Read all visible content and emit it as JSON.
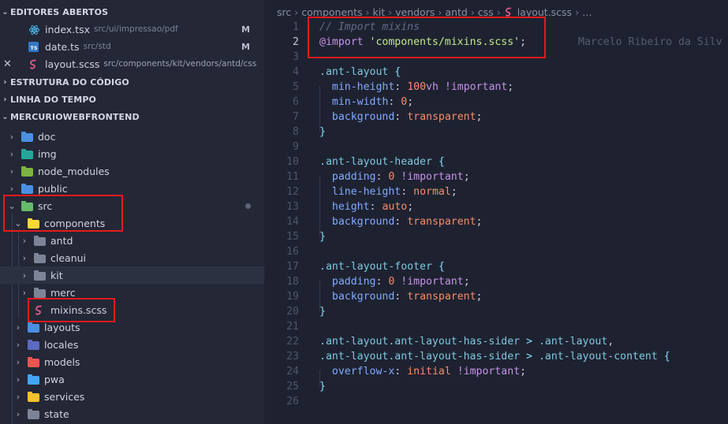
{
  "sidebar": {
    "open_editors": {
      "title": "EDITORES ABERTOS",
      "files": [
        {
          "name": "index.tsx",
          "path": "src/ui/impressao/pdf",
          "badge": "M"
        },
        {
          "name": "date.ts",
          "path": "src/std",
          "badge": "M"
        },
        {
          "name": "layout.scss",
          "path": "src/components/kit/vendors/antd/css",
          "badge": ""
        }
      ]
    },
    "outline_title": "ESTRUTURA DO CÓDIGO",
    "timeline_title": "LINHA DO TEMPO",
    "project_title": "MERCURIOWEBFRONTEND",
    "tree": [
      {
        "label": "doc",
        "color": "#4a90e2",
        "open": false
      },
      {
        "label": "img",
        "color": "#26a69a",
        "open": false
      },
      {
        "label": "node_modules",
        "color": "#7cb342",
        "open": false
      },
      {
        "label": "public",
        "color": "#4a90e2",
        "open": false
      },
      {
        "label": "src",
        "color": "#66bb6a",
        "open": true
      },
      {
        "label": "components",
        "color": "#fdd835",
        "open": true
      },
      {
        "label": "antd",
        "color": "#7e8497",
        "open": false
      },
      {
        "label": "cleanui",
        "color": "#7e8497",
        "open": false
      },
      {
        "label": "kit",
        "color": "#7e8497",
        "open": false
      },
      {
        "label": "merc",
        "color": "#7e8497",
        "open": false
      },
      {
        "label": "mixins.scss",
        "color": "#e05c8a",
        "open": false
      },
      {
        "label": "layouts",
        "color": "#4a90e2",
        "open": false
      },
      {
        "label": "locales",
        "color": "#5c6bc0",
        "open": false
      },
      {
        "label": "models",
        "color": "#ef5350",
        "open": false
      },
      {
        "label": "pwa",
        "color": "#42a5f5",
        "open": false
      },
      {
        "label": "services",
        "color": "#fbc02d",
        "open": false
      },
      {
        "label": "state",
        "color": "#7e8497",
        "open": false
      }
    ]
  },
  "breadcrumb": [
    "src",
    "components",
    "kit",
    "vendors",
    "antd",
    "css",
    "layout.scss",
    "…"
  ],
  "colors": {
    "highlight_box": "#e51b1b",
    "sidebar_bg": "#232736",
    "editor_bg": "#1e2230"
  },
  "code": {
    "blame": "Marcelo Ribeiro da Silv",
    "lines": [
      "// Import mixins",
      "@import 'components/mixins.scss';",
      "",
      ".ant-layout {",
      "  min-height: 100vh !important;",
      "  min-width: 0;",
      "  background: transparent;",
      "}",
      "",
      ".ant-layout-header {",
      "  padding: 0 !important;",
      "  line-height: normal;",
      "  height: auto;",
      "  background: transparent;",
      "}",
      "",
      ".ant-layout-footer {",
      "  padding: 0 !important;",
      "  background: transparent;",
      "}",
      "",
      ".ant-layout.ant-layout-has-sider > .ant-layout,",
      ".ant-layout.ant-layout-has-sider > .ant-layout-content {",
      "  overflow-x: initial !important;",
      "}",
      ""
    ]
  }
}
